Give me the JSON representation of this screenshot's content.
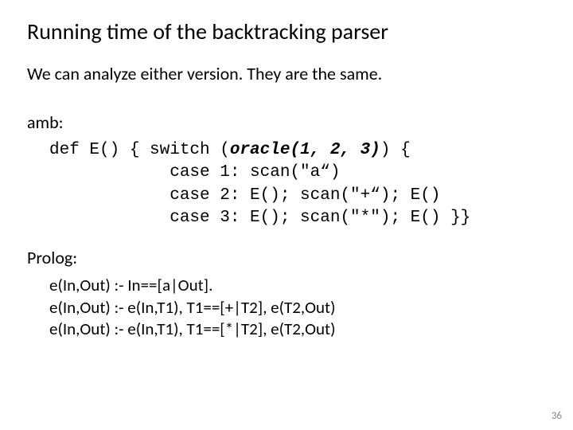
{
  "title": "Running time of the backtracking parser",
  "intro": "We can analyze either version.  They are the same.",
  "amb_label": "amb:",
  "code": {
    "l1a": "def E() { switch (",
    "l1_oracle": "oracle(1, 2, 3)",
    "l1b": ") {",
    "l2": "            case 1: scan(\"a“)",
    "l3": "            case 2: E(); scan(\"+“); E()",
    "l4": "            case 3: E(); scan(\"*\"); E() }}"
  },
  "prolog_label": "Prolog:",
  "prolog": {
    "p1": "e(In,Out) :- In==[a|Out].",
    "p2": "e(In,Out) :- e(In,T1), T1==[+|T2], e(T2,Out)",
    "p3": "e(In,Out) :- e(In,T1), T1==[*|T2], e(T2,Out)"
  },
  "page_number": "36"
}
